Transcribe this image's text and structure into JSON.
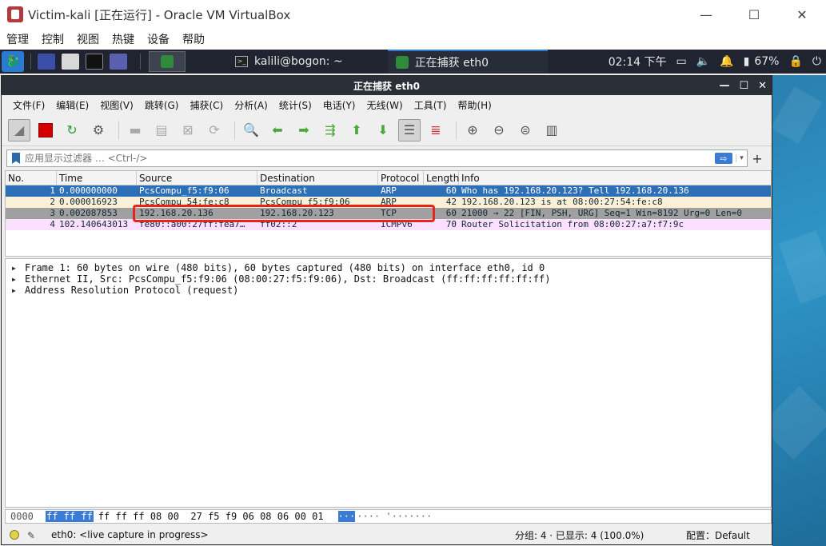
{
  "vbox": {
    "title": "Victim-kali [正在运行] - Oracle VM VirtualBox",
    "menu": [
      "管理",
      "控制",
      "视图",
      "热键",
      "设备",
      "帮助"
    ],
    "controls": {
      "minimize": "—",
      "maximize": "☐",
      "close": "✕"
    }
  },
  "panel": {
    "terminal_task": "kalili@bogon: ~",
    "wireshark_task": "正在捕获 eth0",
    "clock": "02:14 下午",
    "battery": "67%"
  },
  "wireshark": {
    "title": "正在捕获 eth0",
    "controls": {
      "minimize": "—",
      "maximize": "☐",
      "close": "✕"
    },
    "menu": [
      "文件(F)",
      "编辑(E)",
      "视图(V)",
      "跳转(G)",
      "捕获(C)",
      "分析(A)",
      "统计(S)",
      "电话(Y)",
      "无线(W)",
      "工具(T)",
      "帮助(H)"
    ],
    "filter_placeholder": "应用显示过滤器 … <Ctrl-/>",
    "columns": [
      "No.",
      "Time",
      "Source",
      "Destination",
      "Protocol",
      "Length",
      "Info"
    ],
    "packets": [
      {
        "no": "1",
        "time": "0.000000000",
        "src": "PcsCompu_f5:f9:06",
        "dst": "Broadcast",
        "proto": "ARP",
        "len": "60",
        "info": "Who has 192.168.20.123? Tell 192.168.20.136",
        "bg": "#2c6fb7",
        "fg": "#ffffff"
      },
      {
        "no": "2",
        "time": "0.000016923",
        "src": "PcsCompu_54:fe:c8",
        "dst": "PcsCompu_f5:f9:06",
        "proto": "ARP",
        "len": "42",
        "info": "192.168.20.123 is at 08:00:27:54:fe:c8",
        "bg": "#faf0d7",
        "fg": "#12272e"
      },
      {
        "no": "3",
        "time": "0.002087853",
        "src": "192.168.20.136",
        "dst": "192.168.20.123",
        "proto": "TCP",
        "len": "60",
        "info": "21000 → 22 [FIN, PSH, URG] Seq=1 Win=8192 Urg=0 Len=0",
        "bg": "#a0a0a0",
        "fg": "#12272e"
      },
      {
        "no": "4",
        "time": "102.140643013",
        "src": "fe80::a00:27ff:fea7…",
        "dst": "ff02::2",
        "proto": "ICMPv6",
        "len": "70",
        "info": "Router Solicitation from 08:00:27:a7:f7:9c",
        "bg": "#fce0ff",
        "fg": "#12272e"
      }
    ],
    "details": [
      "Frame 1: 60 bytes on wire (480 bits), 60 bytes captured (480 bits) on interface eth0, id 0",
      "Ethernet II, Src: PcsCompu_f5:f9:06 (08:00:27:f5:f9:06), Dst: Broadcast (ff:ff:ff:ff:ff:ff)",
      "Address Resolution Protocol (request)"
    ],
    "bytes": {
      "offset": "0000",
      "selected_hex": "ff ff ff",
      "rest_hex": "ff ff ff 08 00  27 f5 f9 06 08 06 00 01",
      "selected_ascii": "···",
      "rest_ascii": "···· '·······"
    },
    "status": {
      "interface": "eth0: <live capture in progress>",
      "stats": "分组: 4 · 已显示: 4 (100.0%)",
      "profile": "配置：Default"
    }
  }
}
